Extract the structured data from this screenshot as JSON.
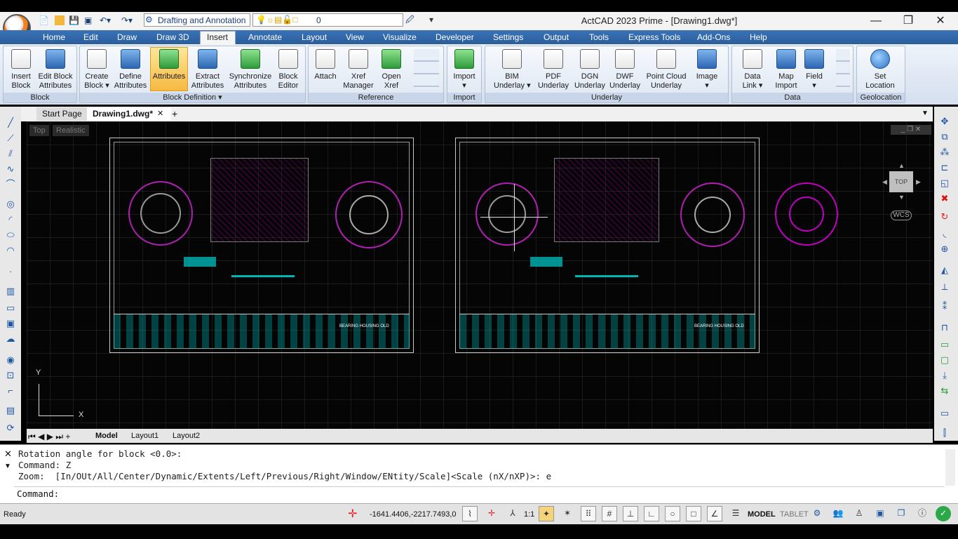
{
  "app": {
    "title": "ActCAD 2023 Prime - [Drawing1.dwg*]"
  },
  "quick_access": {
    "workspace": "Drafting and Annotation",
    "layer": "0"
  },
  "menu": [
    "Home",
    "Edit",
    "Draw",
    "Draw 3D",
    "Insert",
    "Annotate",
    "Layout",
    "View",
    "Visualize",
    "Developer",
    "Settings",
    "Output",
    "Tools",
    "Express Tools",
    "Add-Ons",
    "Help"
  ],
  "ribbon": {
    "block": {
      "title": "Block",
      "insert": "Insert\nBlock",
      "edit_attr": "Edit Block\nAttributes"
    },
    "block_def": {
      "title": "Block Definition ▾",
      "create": "Create\nBlock ▾",
      "define": "Define\nAttributes",
      "attributes": "Attributes",
      "extract": "Extract\nAttributes",
      "sync": "Synchronize\nAttributes",
      "editor": "Block\nEditor"
    },
    "reference": {
      "title": "Reference",
      "attach": "Attach",
      "xref": "Xref\nManager",
      "open": "Open\nXref"
    },
    "import": {
      "title": "Import",
      "import": "Import\n▾"
    },
    "underlay": {
      "title": "Underlay",
      "bim": "BIM\nUnderlay ▾",
      "pdf": "PDF\nUnderlay",
      "dgn": "DGN\nUnderlay",
      "dwf": "DWF\nUnderlay",
      "pointcloud": "Point Cloud\nUnderlay",
      "image": "Image\n▾"
    },
    "data": {
      "title": "Data",
      "datalink": "Data\nLink ▾",
      "mapimport": "Map\nImport",
      "field": "Field\n▾"
    },
    "geolocation": {
      "title": "Geolocation",
      "set": "Set\nLocation"
    }
  },
  "doc_tabs": {
    "start": "Start Page",
    "drawing": "Drawing1.dwg*",
    "close": "✕",
    "add": "+"
  },
  "viewport": {
    "view": "Top",
    "style": "Realistic",
    "viewcube": "TOP",
    "wcs": "WCS",
    "title_text": "BEARING HOUSING OLD"
  },
  "ucs": {
    "x": "X",
    "y": "Y"
  },
  "layout_tabs": {
    "model": "Model",
    "layout1": "Layout1",
    "layout2": "Layout2"
  },
  "command": {
    "line1": "Rotation angle for block <0.0>:",
    "line2": "Command: Z",
    "line3": "Zoom:  [In/OUt/All/Center/Dynamic/Extents/Left/Previous/Right/Window/ENtity/Scale]<Scale (nX/nXP)>: e",
    "prompt": "Command:"
  },
  "status": {
    "ready": "Ready",
    "coords": "-1641.4406,-2217.7493,0",
    "scale": "1:1",
    "model": "MODEL",
    "tablet": "TABLET"
  },
  "colors": {
    "menubar": "#2f66a8",
    "drawing_cyan": "#00b4b4",
    "drawing_magenta": "#c000c0",
    "ribbon_highlight": "#f5b940"
  }
}
